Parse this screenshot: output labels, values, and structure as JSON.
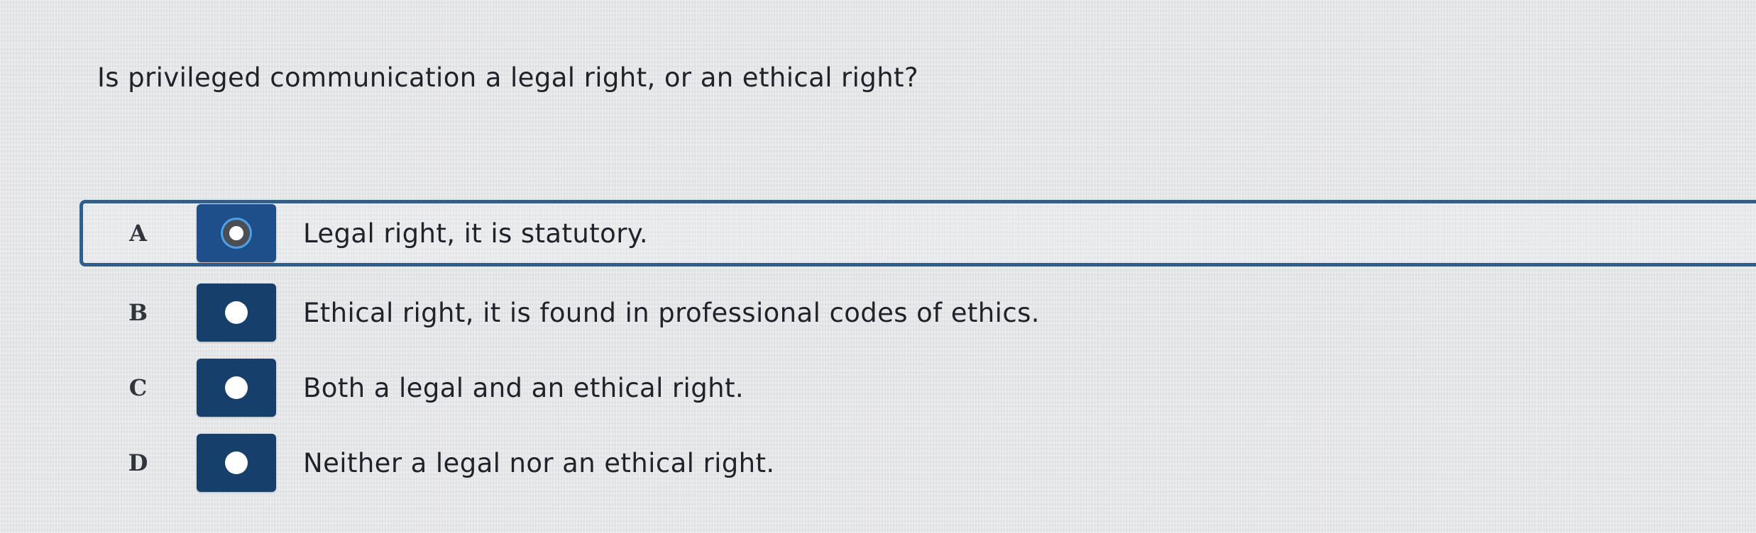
{
  "question": {
    "text": "Is privileged communication a legal right, or an ethical right?"
  },
  "options": [
    {
      "letter": "A",
      "text": "Legal right, it is statutory.",
      "selected": true,
      "icon": "radio-selected-icon"
    },
    {
      "letter": "B",
      "text": "Ethical right, it is found in professional codes of ethics.",
      "selected": false,
      "icon": "radio-unselected-icon"
    },
    {
      "letter": "C",
      "text": "Both a legal and an ethical right.",
      "selected": false,
      "icon": "radio-unselected-icon"
    },
    {
      "letter": "D",
      "text": "Neither a legal nor an ethical right.",
      "selected": false,
      "icon": "radio-unselected-icon"
    }
  ],
  "colors": {
    "background": "#e9eaec",
    "radio_button": "#173f6c",
    "selected_border": "#2f5f8d",
    "focus_ring": "#4fa0ea"
  }
}
